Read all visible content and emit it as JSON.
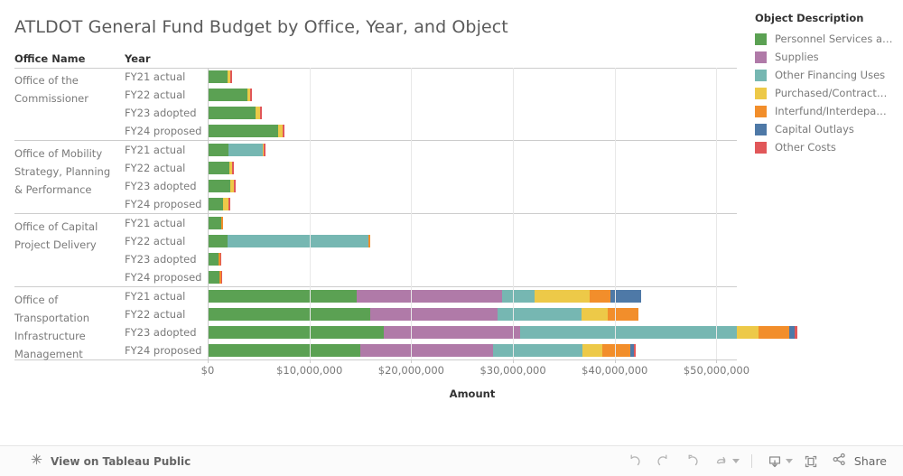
{
  "viz": {
    "title": "ATLDOT General Fund Budget by Office, Year, and Object"
  },
  "columns": {
    "office_header": "Office Name",
    "year_header": "Year"
  },
  "axis": {
    "title": "Amount",
    "ticks": [
      {
        "label": "$0",
        "value": 0
      },
      {
        "label": "$10,000,000",
        "value": 10000000
      },
      {
        "label": "$20,000,000",
        "value": 20000000
      },
      {
        "label": "$30,000,000",
        "value": 30000000
      },
      {
        "label": "$40,000,000",
        "value": 40000000
      },
      {
        "label": "$50,000,000",
        "value": 50000000
      }
    ],
    "min": 0,
    "max": 52000000
  },
  "legend": {
    "title": "Object Description",
    "items": [
      {
        "label": "Personnel Services a…",
        "color": "#5ba153",
        "key": "personnel"
      },
      {
        "label": "Supplies",
        "color": "#b07aa8",
        "key": "supplies"
      },
      {
        "label": "Other Financing Uses",
        "color": "#76b7b2",
        "key": "other_financing"
      },
      {
        "label": "Purchased/Contract…",
        "color": "#edc948",
        "key": "purchased"
      },
      {
        "label": "Interfund/Interdepa…",
        "color": "#f28e2b",
        "key": "interfund"
      },
      {
        "label": "Capital Outlays",
        "color": "#4e79a7",
        "key": "capital"
      },
      {
        "label": "Other Costs",
        "color": "#e15759",
        "key": "other_costs"
      }
    ]
  },
  "chart_data": {
    "type": "bar",
    "orientation": "horizontal",
    "stacked": true,
    "title": "ATLDOT General Fund Budget by Office, Year, and Object",
    "xlabel": "Amount",
    "ylabel": "",
    "xlim": [
      0,
      52000000
    ],
    "grid": true,
    "legend_position": "right",
    "series": [
      {
        "name": "Personnel Services a…",
        "color": "#5ba153"
      },
      {
        "name": "Supplies",
        "color": "#b07aa8"
      },
      {
        "name": "Other Financing Uses",
        "color": "#76b7b2"
      },
      {
        "name": "Purchased/Contract…",
        "color": "#edc948"
      },
      {
        "name": "Interfund/Interdepa…",
        "color": "#f28e2b"
      },
      {
        "name": "Capital Outlays",
        "color": "#4e79a7"
      },
      {
        "name": "Other Costs",
        "color": "#e15759"
      }
    ],
    "groups": [
      {
        "office": "Office of the Commissioner",
        "rows": [
          {
            "year": "FY21 actual",
            "values": {
              "personnel": 1960000,
              "supplies": 0,
              "other_financing": 0,
              "purchased": 270000,
              "interfund": 0,
              "capital": 0,
              "other_costs": 180000
            }
          },
          {
            "year": "FY22 actual",
            "values": {
              "personnel": 3930000,
              "supplies": 0,
              "other_financing": 0,
              "purchased": 270000,
              "interfund": 0,
              "capital": 0,
              "other_costs": 180000
            }
          },
          {
            "year": "FY23 adopted",
            "values": {
              "personnel": 4730000,
              "supplies": 0,
              "other_financing": 0,
              "purchased": 450000,
              "interfund": 0,
              "capital": 0,
              "other_costs": 180000
            }
          },
          {
            "year": "FY24 proposed",
            "values": {
              "personnel": 6880000,
              "supplies": 0,
              "other_financing": 0,
              "purchased": 450000,
              "interfund": 0,
              "capital": 0,
              "other_costs": 180000
            }
          }
        ]
      },
      {
        "office": "Office of Mobility Strategy, Planning & Performance",
        "rows": [
          {
            "year": "FY21 actual",
            "values": {
              "personnel": 2060000,
              "supplies": 0,
              "other_financing": 3390000,
              "purchased": 90000,
              "interfund": 0,
              "capital": 0,
              "other_costs": 180000
            }
          },
          {
            "year": "FY22 actual",
            "values": {
              "personnel": 2150000,
              "supplies": 0,
              "other_financing": 0,
              "purchased": 270000,
              "interfund": 0,
              "capital": 0,
              "other_costs": 180000
            }
          },
          {
            "year": "FY23 adopted",
            "values": {
              "personnel": 2240000,
              "supplies": 0,
              "other_financing": 0,
              "purchased": 360000,
              "interfund": 0,
              "capital": 0,
              "other_costs": 180000
            }
          },
          {
            "year": "FY24 proposed",
            "values": {
              "personnel": 1520000,
              "supplies": 0,
              "other_financing": 0,
              "purchased": 540000,
              "interfund": 0,
              "capital": 0,
              "other_costs": 180000
            }
          }
        ]
      },
      {
        "office": "Office of Capital Project Delivery",
        "rows": [
          {
            "year": "FY21 actual",
            "values": {
              "personnel": 1340000,
              "supplies": 0,
              "other_financing": 0,
              "purchased": 0,
              "interfund": 180000,
              "capital": 0,
              "other_costs": 0
            }
          },
          {
            "year": "FY22 actual",
            "values": {
              "personnel": 1960000,
              "supplies": 0,
              "other_financing": 13840000,
              "purchased": 0,
              "interfund": 180000,
              "capital": 0,
              "other_costs": 0
            }
          },
          {
            "year": "FY23 adopted",
            "values": {
              "personnel": 1070000,
              "supplies": 0,
              "other_financing": 0,
              "purchased": 0,
              "interfund": 180000,
              "capital": 0,
              "other_costs": 90000
            }
          },
          {
            "year": "FY24 proposed",
            "values": {
              "personnel": 1160000,
              "supplies": 0,
              "other_financing": 0,
              "purchased": 0,
              "interfund": 180000,
              "capital": 0,
              "other_costs": 90000
            }
          }
        ]
      },
      {
        "office": "Office of Transportation Infrastructure Management",
        "rows": [
          {
            "year": "FY21 actual",
            "values": {
              "personnel": 14640000,
              "supplies": 14290000,
              "other_financing": 3210000,
              "purchased": 5360000,
              "interfund": 2050000,
              "capital": 3040000,
              "other_costs": 0
            }
          },
          {
            "year": "FY22 actual",
            "values": {
              "personnel": 15980000,
              "supplies": 12500000,
              "other_financing": 8300000,
              "purchased": 2500000,
              "interfund": 3040000,
              "capital": 0,
              "other_costs": 0
            }
          },
          {
            "year": "FY23 adopted",
            "values": {
              "personnel": 17320000,
              "supplies": 13390000,
              "other_financing": 21250000,
              "purchased": 2140000,
              "interfund": 3040000,
              "capital": 540000,
              "other_costs": 270000
            }
          },
          {
            "year": "FY24 proposed",
            "values": {
              "personnel": 15000000,
              "supplies": 13040000,
              "other_financing": 8750000,
              "purchased": 1960000,
              "interfund": 2770000,
              "capital": 360000,
              "other_costs": 180000
            }
          }
        ]
      }
    ]
  },
  "toolbar": {
    "tableau_public_label": "View on Tableau Public",
    "undo_label": "Undo",
    "redo_label": "Redo",
    "revert_label": "Revert",
    "refresh_label": "Refresh",
    "pause_label": "Pause",
    "download_label": "Download",
    "fullscreen_label": "Full Screen",
    "share_label": "Share"
  }
}
